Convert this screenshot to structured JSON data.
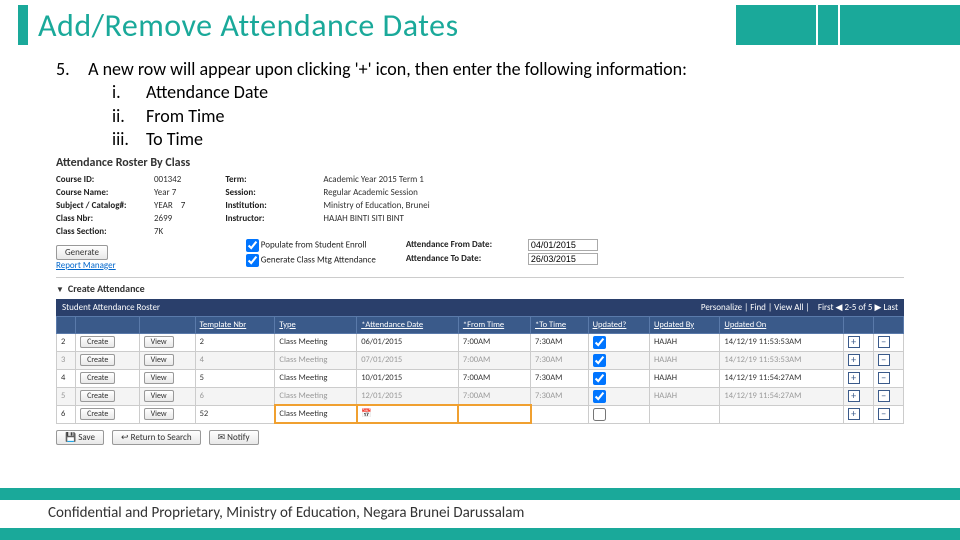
{
  "title": "Add/Remove Attendance Dates",
  "step": {
    "num": "5.",
    "text": "A new row will appear upon clicking '+' icon, then enter the following information:",
    "subs": [
      {
        "num": "i.",
        "text": "Attendance Date"
      },
      {
        "num": "ii.",
        "text": "From Time"
      },
      {
        "num": "iii.",
        "text": "To Time"
      }
    ]
  },
  "screenshot": {
    "heading": "Attendance Roster By Class",
    "left": [
      {
        "lbl": "Course ID:",
        "val": "001342"
      },
      {
        "lbl": "Course Name:",
        "val": "Year 7"
      },
      {
        "lbl": "Subject / Catalog#:",
        "val": "YEAR",
        "val2": "7"
      },
      {
        "lbl": "Class Nbr:",
        "val": "2699"
      },
      {
        "lbl": "Class Section:",
        "val": "7K"
      }
    ],
    "right": [
      {
        "lbl": "Term:",
        "val": "Academic Year 2015 Term 1"
      },
      {
        "lbl": "Session:",
        "val": "Regular Academic Session"
      },
      {
        "lbl": "Institution:",
        "val": "Ministry of Education, Brunei"
      },
      {
        "lbl": "Instructor:",
        "val": "HAJAH BINTI SITI BINT"
      }
    ],
    "generate_btn": "Generate",
    "report_link": "Report Manager",
    "chk1": "Populate from Student Enroll",
    "chk2": "Generate Class Mtg Attendance",
    "from_lbl": "Attendance From Date:",
    "from_val": "04/01/2015",
    "to_lbl": "Attendance To Date:",
    "to_val": "26/03/2015",
    "create_lbl": "Create Attendance",
    "roster_title": "Student Attendance Roster",
    "roster_links": "Personalize | Find | View All |",
    "roster_nav": "First ◀ 2-5 of 5 ▶ Last",
    "cols": [
      "",
      "",
      "",
      "Template Nbr",
      "Type",
      "*Attendance Date",
      "*From Time",
      "*To Time",
      "Updated?",
      "Updated By",
      "Updated On",
      "",
      ""
    ],
    "rows": [
      {
        "n": "2",
        "c": "Create",
        "v": "View",
        "t": "2",
        "type": "Class Meeting",
        "date": "06/01/2015",
        "from": "7:00AM",
        "to": "7:30AM",
        "u": true,
        "by": "HAJAH",
        "on": "14/12/19 11:53:53AM"
      },
      {
        "n": "3",
        "c": "Create",
        "v": "View",
        "t": "4",
        "type": "Class Meeting",
        "date": "07/01/2015",
        "from": "7:00AM",
        "to": "7:30AM",
        "u": true,
        "by": "HAJAH",
        "on": "14/12/19 11:53:53AM"
      },
      {
        "n": "4",
        "c": "Create",
        "v": "View",
        "t": "5",
        "type": "Class Meeting",
        "date": "10/01/2015",
        "from": "7:00AM",
        "to": "7:30AM",
        "u": true,
        "by": "HAJAH",
        "on": "14/12/19 11:54:27AM"
      },
      {
        "n": "5",
        "c": "Create",
        "v": "View",
        "t": "6",
        "type": "Class Meeting",
        "date": "12/01/2015",
        "from": "7:00AM",
        "to": "7:30AM",
        "u": true,
        "by": "HAJAH",
        "on": "14/12/19 11:54:27AM"
      },
      {
        "n": "6",
        "c": "Create",
        "v": "View",
        "t": "52",
        "type": "Class Meeting",
        "date": "",
        "from": "",
        "to": "",
        "u": false,
        "by": "",
        "on": ""
      }
    ],
    "save": "Save",
    "return": "Return to Search",
    "notify": "Notify"
  },
  "footer": "Confidential and Proprietary, Ministry of Education, Negara Brunei Darussalam"
}
